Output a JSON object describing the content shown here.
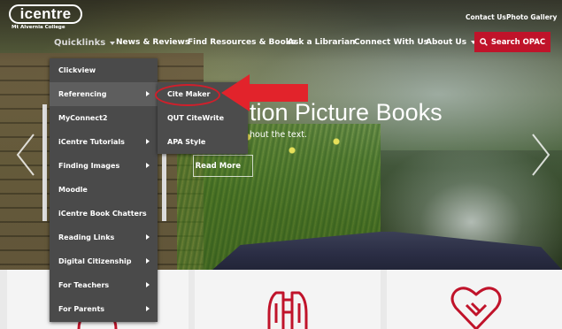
{
  "brand": {
    "logo_text": "icentre",
    "logo_sub": "Mt Alvernia College"
  },
  "utility": {
    "contact": "Contact Us",
    "gallery": "Photo Gallery"
  },
  "nav": {
    "quicklinks": "Quicklinks",
    "news": "News & Reviews",
    "find": "Find Resources & Books",
    "ask": "Ask a Librarian",
    "connect": "Connect With Us",
    "about": "About Us",
    "search": "Search OPAC"
  },
  "menu": {
    "items": [
      {
        "label": "Clickview"
      },
      {
        "label": "Referencing"
      },
      {
        "label": "MyConnect2"
      },
      {
        "label": "iCentre Tutorials"
      },
      {
        "label": "Finding Images"
      },
      {
        "label": "Moodle"
      },
      {
        "label": "iCentre Book Chatters"
      },
      {
        "label": "Reading Links"
      },
      {
        "label": "Digital Citizenship"
      },
      {
        "label": "For Teachers"
      },
      {
        "label": "For Parents"
      }
    ],
    "active": "Referencing"
  },
  "submenu": {
    "items": [
      {
        "label": "Cite Maker"
      },
      {
        "label": "QUT CiteWrite"
      },
      {
        "label": "APA Style"
      }
    ]
  },
  "hero": {
    "title": "tion Picture Books",
    "subtitle": "hout the text.",
    "cta": "Read More"
  },
  "colors": {
    "accent": "#c0132a",
    "menu_bg": "#4a4a4a",
    "annotation": "#d11f2b"
  },
  "icons": [
    "search-icon",
    "binoculars-icon",
    "heart-handshake-icon",
    "chevron-left-icon",
    "chevron-right-icon"
  ]
}
